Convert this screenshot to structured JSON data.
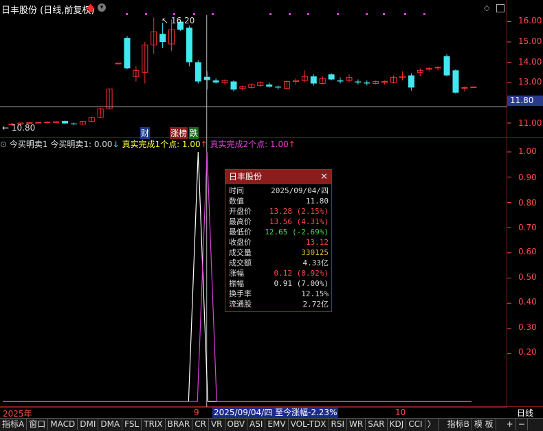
{
  "header": {
    "title": "日丰股份 (日线,前复权)"
  },
  "price_axis": {
    "labels": [
      "16.00",
      "15.00",
      "14.00",
      "13.00",
      "11.00"
    ],
    "current_price_tag": "11.80"
  },
  "chart_annotations": {
    "high_label": "16.20",
    "low_label": "10.80",
    "badges": [
      "财",
      "涨榜",
      "跌"
    ]
  },
  "indicator": {
    "name": "今买明卖1",
    "value_label": "今买明卖1: 0.00",
    "line1_label": "真实完成1个点: 1.00",
    "line2_label": "真实完成2个点: 1.00",
    "axis_labels": [
      "1.00",
      "0.90",
      "0.80",
      "0.70",
      "0.60",
      "0.50",
      "0.40",
      "0.30",
      "0.20"
    ]
  },
  "popup": {
    "title": "日丰股份",
    "rows": [
      {
        "k": "时间",
        "v": "2025/09/04/四"
      },
      {
        "k": "数值",
        "v": "11.80"
      },
      {
        "k": "开盘价",
        "v": "13.28 (2.15%)"
      },
      {
        "k": "最高价",
        "v": "13.56 (4.31%)"
      },
      {
        "k": "最低价",
        "v": "12.65 (-2.69%)"
      },
      {
        "k": "收盘价",
        "v": "13.12"
      },
      {
        "k": "成交量",
        "v": "330125"
      },
      {
        "k": "成交额",
        "v": "4.33亿"
      },
      {
        "k": "涨幅",
        "v": "0.12 (0.92%)"
      },
      {
        "k": "振幅",
        "v": "0.91 (7.00%)"
      },
      {
        "k": "换手率",
        "v": "12.15%"
      },
      {
        "k": "流通股",
        "v": "2.72亿"
      }
    ]
  },
  "date_bar": {
    "year": "2025年",
    "month9": "9",
    "month10": "10",
    "cursor": "2025/09/04/四  至今涨幅-2.23%",
    "period": "日线"
  },
  "tabs": [
    "指标A",
    "窗口",
    "MACD",
    "DMI",
    "DMA",
    "FSL",
    "TRIX",
    "BRAR",
    "CR",
    "VR",
    "OBV",
    "ASI",
    "EMV",
    "VOL-TDX",
    "RSI",
    "WR",
    "SAR",
    "KDJ",
    "CCI",
    "〉",
    "指标B",
    "模 板",
    "+",
    "−"
  ],
  "chart_data": {
    "type": "candlestick",
    "candles": [
      {
        "o": 10.92,
        "h": 11.0,
        "l": 10.85,
        "c": 10.95
      },
      {
        "o": 10.95,
        "h": 11.02,
        "l": 10.9,
        "c": 11.0
      },
      {
        "o": 11.0,
        "h": 11.05,
        "l": 10.96,
        "c": 11.02
      },
      {
        "o": 11.02,
        "h": 11.06,
        "l": 10.98,
        "c": 11.03
      },
      {
        "o": 11.03,
        "h": 11.08,
        "l": 11.0,
        "c": 11.05
      },
      {
        "o": 11.05,
        "h": 11.1,
        "l": 11.0,
        "c": 11.06
      },
      {
        "o": 11.1,
        "h": 11.12,
        "l": 10.95,
        "c": 10.98
      },
      {
        "o": 10.98,
        "h": 11.02,
        "l": 10.9,
        "c": 10.95
      },
      {
        "o": 10.95,
        "h": 11.1,
        "l": 10.92,
        "c": 11.08
      },
      {
        "o": 11.08,
        "h": 11.3,
        "l": 11.05,
        "c": 11.28
      },
      {
        "o": 11.28,
        "h": 11.75,
        "l": 11.25,
        "c": 11.7
      },
      {
        "o": 11.7,
        "h": 12.7,
        "l": 11.68,
        "c": 12.68
      },
      {
        "o": 13.95,
        "h": 13.97,
        "l": 13.9,
        "c": 13.95
      },
      {
        "o": 15.2,
        "h": 15.3,
        "l": 13.65,
        "c": 13.7
      },
      {
        "o": 13.3,
        "h": 13.8,
        "l": 13.05,
        "c": 13.6
      },
      {
        "o": 13.5,
        "h": 15.0,
        "l": 12.95,
        "c": 14.85
      },
      {
        "o": 14.85,
        "h": 16.2,
        "l": 14.4,
        "c": 15.5
      },
      {
        "o": 15.4,
        "h": 15.95,
        "l": 14.7,
        "c": 15.0
      },
      {
        "o": 14.9,
        "h": 16.1,
        "l": 14.55,
        "c": 15.6
      },
      {
        "o": 16.0,
        "h": 16.1,
        "l": 15.55,
        "c": 15.6
      },
      {
        "o": 15.7,
        "h": 15.8,
        "l": 13.8,
        "c": 14.0
      },
      {
        "o": 14.0,
        "h": 14.1,
        "l": 12.95,
        "c": 13.05
      },
      {
        "o": 13.28,
        "h": 13.56,
        "l": 12.65,
        "c": 13.12
      },
      {
        "o": 13.1,
        "h": 13.2,
        "l": 12.95,
        "c": 13.0
      },
      {
        "o": 13.0,
        "h": 13.15,
        "l": 12.9,
        "c": 13.1
      },
      {
        "o": 13.05,
        "h": 13.1,
        "l": 12.55,
        "c": 12.65
      },
      {
        "o": 12.7,
        "h": 12.85,
        "l": 12.6,
        "c": 12.8
      },
      {
        "o": 12.75,
        "h": 12.95,
        "l": 12.7,
        "c": 12.9
      },
      {
        "o": 12.85,
        "h": 13.05,
        "l": 12.8,
        "c": 13.0
      },
      {
        "o": 12.9,
        "h": 13.0,
        "l": 12.75,
        "c": 12.8
      },
      {
        "o": 12.8,
        "h": 12.85,
        "l": 12.65,
        "c": 12.75
      },
      {
        "o": 12.7,
        "h": 13.1,
        "l": 12.65,
        "c": 13.05
      },
      {
        "o": 13.05,
        "h": 13.2,
        "l": 12.9,
        "c": 13.1
      },
      {
        "o": 13.1,
        "h": 13.6,
        "l": 13.0,
        "c": 13.3
      },
      {
        "o": 13.3,
        "h": 13.4,
        "l": 12.85,
        "c": 12.95
      },
      {
        "o": 12.95,
        "h": 13.3,
        "l": 12.9,
        "c": 13.2
      },
      {
        "o": 13.4,
        "h": 13.45,
        "l": 13.1,
        "c": 13.15
      },
      {
        "o": 13.1,
        "h": 13.25,
        "l": 12.95,
        "c": 13.05
      },
      {
        "o": 13.1,
        "h": 13.4,
        "l": 13.0,
        "c": 13.25
      },
      {
        "o": 13.05,
        "h": 13.15,
        "l": 12.9,
        "c": 13.0
      },
      {
        "o": 13.0,
        "h": 13.1,
        "l": 12.85,
        "c": 12.95
      },
      {
        "o": 12.95,
        "h": 13.1,
        "l": 12.9,
        "c": 13.05
      },
      {
        "o": 13.0,
        "h": 13.1,
        "l": 12.9,
        "c": 13.05
      },
      {
        "o": 13.0,
        "h": 13.35,
        "l": 12.95,
        "c": 13.25
      },
      {
        "o": 13.25,
        "h": 13.55,
        "l": 13.1,
        "c": 13.3
      },
      {
        "o": 13.35,
        "h": 13.45,
        "l": 12.6,
        "c": 12.75
      },
      {
        "o": 13.5,
        "h": 13.7,
        "l": 13.3,
        "c": 13.6
      },
      {
        "o": 13.65,
        "h": 13.75,
        "l": 13.55,
        "c": 13.7
      },
      {
        "o": 13.75,
        "h": 13.8,
        "l": 13.6,
        "c": 13.75
      },
      {
        "o": 14.3,
        "h": 14.4,
        "l": 13.3,
        "c": 13.35
      },
      {
        "o": 13.6,
        "h": 13.65,
        "l": 12.45,
        "c": 12.5
      },
      {
        "o": 12.75,
        "h": 12.8,
        "l": 12.55,
        "c": 12.75
      },
      {
        "o": 12.78,
        "h": 12.8,
        "l": 12.75,
        "c": 12.78
      }
    ],
    "current_price": 11.8,
    "cursor_index": 22,
    "indicator_series": [
      {
        "name": "真实完成1个点",
        "color": "#ffffff",
        "spike_index": 21,
        "value": 1.0
      },
      {
        "name": "真实完成2个点",
        "color": "#e040e0",
        "spike_index": 22,
        "value": 1.0
      }
    ],
    "colors": {
      "up": "#ff3030",
      "down": "#40e8f0",
      "grid": "#8a1c1c"
    }
  }
}
